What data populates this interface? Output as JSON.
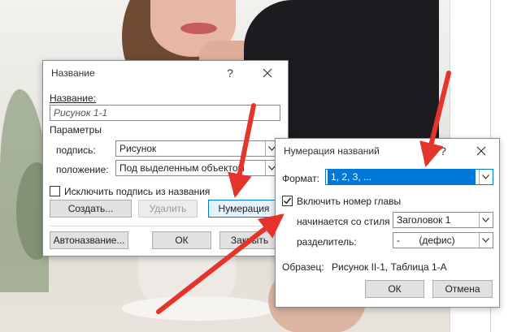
{
  "caption_dialog": {
    "title": "Название",
    "help_icon": "question-mark-icon",
    "close_icon": "close-icon",
    "caption_label": "Название:",
    "caption_value": "Рисунок 1-1",
    "options_label": "Параметры",
    "label_label": "подпись:",
    "label_value": "Рисунок",
    "position_label": "положение:",
    "position_value": "Под выделенным объектом",
    "exclude_label": "Исключить подпись из названия",
    "exclude_checked": false,
    "new_label_button": "Создать...",
    "delete_label_button": "Удалить",
    "numbering_button": "Нумерация",
    "autocaption_button": "Автоназвание...",
    "ok_button": "ОК",
    "cancel_button": "Закрыть"
  },
  "numbering_dialog": {
    "title": "Нумерация названий",
    "help_icon": "question-mark-icon",
    "close_icon": "close-icon",
    "format_label": "Формат:",
    "format_value": "1, 2, 3, ...",
    "include_chapter_label": "Включить номер главы",
    "include_chapter_checked": true,
    "chapter_style_label": "начинается со стиля",
    "chapter_style_value": "Заголовок 1",
    "separator_label": "разделитель:",
    "separator_value": "-       (дефис)",
    "example_label": "Образец:",
    "example_value": "Рисунок II-1, Таблица 1-А",
    "ok_button": "ОК",
    "cancel_button": "Отмена"
  },
  "colors": {
    "arrow": "#e5342b",
    "selection": "#0078d7",
    "focus_border": "#0078d7"
  }
}
